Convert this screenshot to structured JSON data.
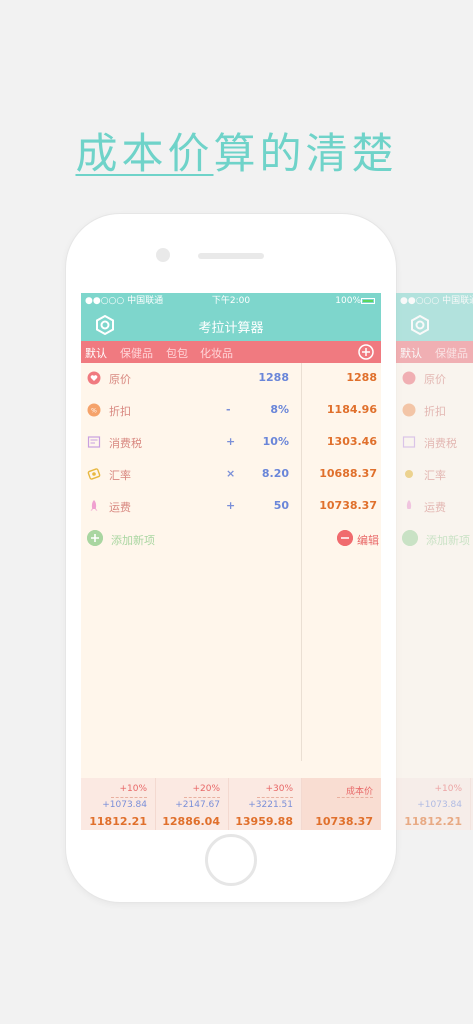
{
  "headline": {
    "part1": "成本价",
    "part2": "算的清楚"
  },
  "status": {
    "carrier": "●●○○○ 中国联通",
    "time": "下午2:00",
    "battery": "100%"
  },
  "app": {
    "title": "考拉计算器"
  },
  "tabs": [
    {
      "label": "默认",
      "active": true
    },
    {
      "label": "保健品",
      "active": false
    },
    {
      "label": "包包",
      "active": false
    },
    {
      "label": "化妆品",
      "active": false
    }
  ],
  "rows": [
    {
      "icon": "heart-icon",
      "label": "原价",
      "op": "",
      "value": "1288",
      "result": "1288"
    },
    {
      "icon": "discount-icon",
      "label": "折扣",
      "op": "-",
      "value": "8%",
      "result": "1184.96"
    },
    {
      "icon": "receipt-icon",
      "label": "消费税",
      "op": "+",
      "value": "10%",
      "result": "1303.46"
    },
    {
      "icon": "exchange-icon",
      "label": "汇率",
      "op": "×",
      "value": "8.20",
      "result": "10688.37"
    },
    {
      "icon": "rocket-icon",
      "label": "运费",
      "op": "+",
      "value": "50",
      "result": "10738.37"
    }
  ],
  "actions": {
    "add_label": "添加新项",
    "edit_label": "编辑"
  },
  "footer": [
    {
      "pct": "+10%",
      "add": "+1073.84",
      "total": "11812.21"
    },
    {
      "pct": "+20%",
      "add": "+2147.67",
      "total": "12886.04"
    },
    {
      "pct": "+30%",
      "add": "+3221.51",
      "total": "13959.88"
    },
    {
      "pct": "成本价",
      "add": "",
      "total": "10738.37"
    }
  ],
  "colors": {
    "accent": "#7ed6cc",
    "tab": "#f07a80",
    "bg": "#fff6eb",
    "result": "#e0702c"
  }
}
